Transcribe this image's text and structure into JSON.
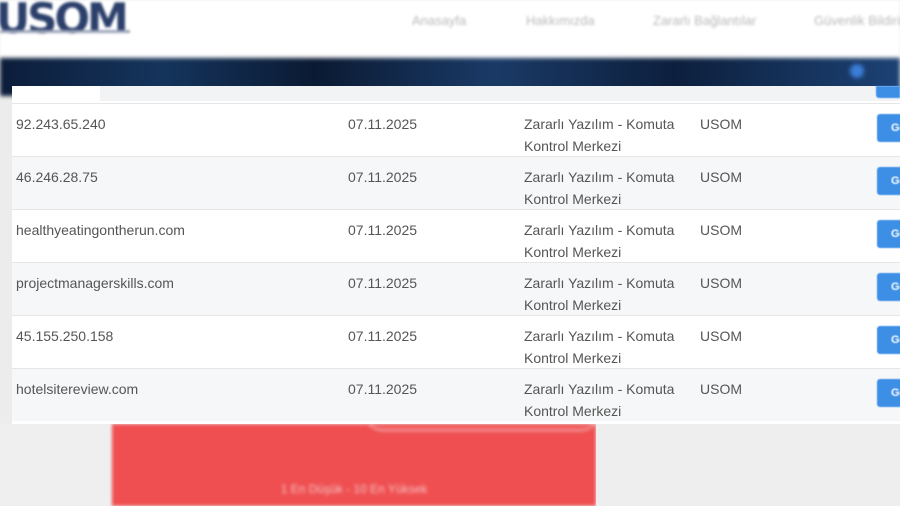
{
  "header": {
    "logo_text": "USOM",
    "nav": [
      "Anasayfa",
      "Hakkımızda",
      "Zararlı Bağlantılar",
      "Güvenlik Bildirimleri"
    ]
  },
  "table": {
    "rows": [
      {
        "host": "92.243.65.240",
        "date": "07.11.2025",
        "type": "Zararlı Yazılım - Komuta Kontrol Merkezi",
        "source": "USOM",
        "button": "Gö"
      },
      {
        "host": "46.246.28.75",
        "date": "07.11.2025",
        "type": "Zararlı Yazılım - Komuta Kontrol Merkezi",
        "source": "USOM",
        "button": "Gö"
      },
      {
        "host": "healthyeatingontherun.com",
        "date": "07.11.2025",
        "type": "Zararlı Yazılım - Komuta Kontrol Merkezi",
        "source": "USOM",
        "button": "Gö"
      },
      {
        "host": "projectmanagerskills.com",
        "date": "07.11.2025",
        "type": "Zararlı Yazılım - Komuta Kontrol Merkezi",
        "source": "USOM",
        "button": "Gö"
      },
      {
        "host": "45.155.250.158",
        "date": "07.11.2025",
        "type": "Zararlı Yazılım - Komuta Kontrol Merkezi",
        "source": "USOM",
        "button": "Gö"
      },
      {
        "host": "hotelsitereview.com",
        "date": "07.11.2025",
        "type": "Zararlı Yazılım - Komuta Kontrol Merkezi",
        "source": "USOM",
        "button": "Gö"
      }
    ]
  },
  "background_card": {
    "scale_text": "1 En Düşük - 10 En Yüksek"
  },
  "colors": {
    "accent_button": "#3d8fe6",
    "background_card": "#ef4f51",
    "logo": "#2b3f6b"
  }
}
